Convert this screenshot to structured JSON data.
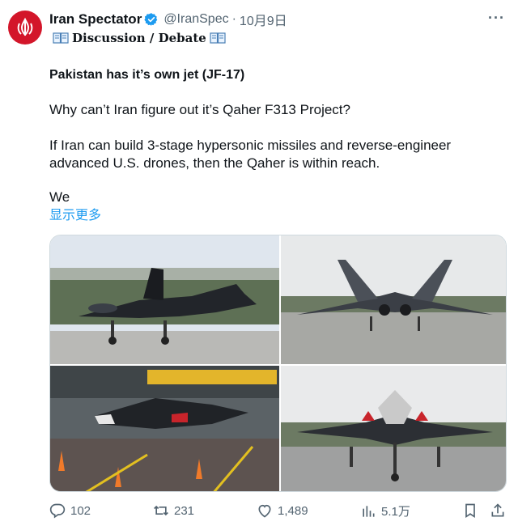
{
  "tweet": {
    "display_name": "Iran Spectator",
    "handle": "@IranSpec",
    "separator": "·",
    "time": "10月9日",
    "more": "···",
    "subline": "Discussion / Debate",
    "title": "Pakistan has it’s own jet (JF-17)",
    "p1": "Why can’t Iran figure out it’s Qaher F313 Project?",
    "p2a": "If Iran can build 3-stage hypersonic missiles and reverse-engineer",
    "p2b": "advanced U.S. drones, then the Qaher is within reach.",
    "p3": "We",
    "show_more": "显示更多"
  },
  "actions": {
    "replies": "102",
    "reposts": "231",
    "likes": "1,489",
    "views": "5.1万"
  },
  "colors": {
    "accent": "#1d9bf0",
    "muted": "#536471",
    "avatar_red": "#d3162a"
  },
  "icons": [
    "verified-badge-icon",
    "book-icon",
    "reply-icon",
    "repost-icon",
    "like-icon",
    "views-icon",
    "bookmark-icon",
    "share-icon",
    "more-icon"
  ]
}
